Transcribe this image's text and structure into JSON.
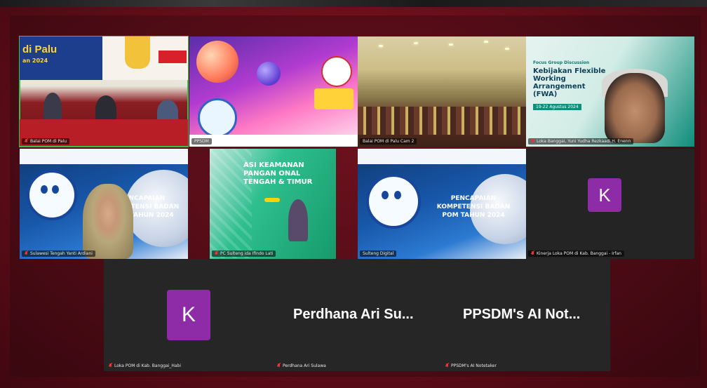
{
  "meeting": {
    "tiles": [
      {
        "name": "Balai POM di Palu",
        "banner": "di Palu",
        "banner_sub": "an 2024",
        "muted": true,
        "active": true
      },
      {
        "name": "PPSDM",
        "muted": false
      },
      {
        "name": "Balai POM di Palu Cam 2",
        "muted": false
      },
      {
        "name": "Loka Banggai, Yuni Yudha Rezkaadi H. Enenn",
        "title_small": "Focus Group Discussion",
        "title_main": "Kebijakan Flexible Working Arrangement (FWA)",
        "date": "19-22 Agustus 2024",
        "muted": true
      },
      {
        "name": "Sulawesi Tengah Yanti Ardiani",
        "poster_title": "PENCAPAIAN KOMPETENSI BADAN POM TAHUN 2024",
        "muted": true
      },
      {
        "name": "PC Sulteng ida Ifindo Lati",
        "poster_title": "ASI KEAMANAN PANGAN ONAL TENGAH & TIMUR",
        "muted": true
      },
      {
        "name": "Sulteng Digital",
        "poster_title": "PENCAPAIAN KOMPETENSI BADAN POM TAHUN 2024",
        "muted": false
      },
      {
        "name": "Kinerja Loka POM di Kab. Banggai - Irfan",
        "avatar_letter": "K",
        "muted": true
      }
    ],
    "bottom": [
      {
        "name": "Loka POM di Kab. Banggai_Habi",
        "avatar_letter": "K",
        "muted": true
      },
      {
        "name": "Perdhana Ari Sulawa",
        "display": "Perdhana Ari Su...",
        "muted": true
      },
      {
        "name": "PPSDM's AI Notetaker",
        "display": "PPSDM's AI Not...",
        "muted": true
      }
    ]
  },
  "colors": {
    "background": "#6b0f1c",
    "avatar": "#8e2ba7",
    "active_speaker": "#34c24a",
    "muted_mic": "#e33333"
  }
}
